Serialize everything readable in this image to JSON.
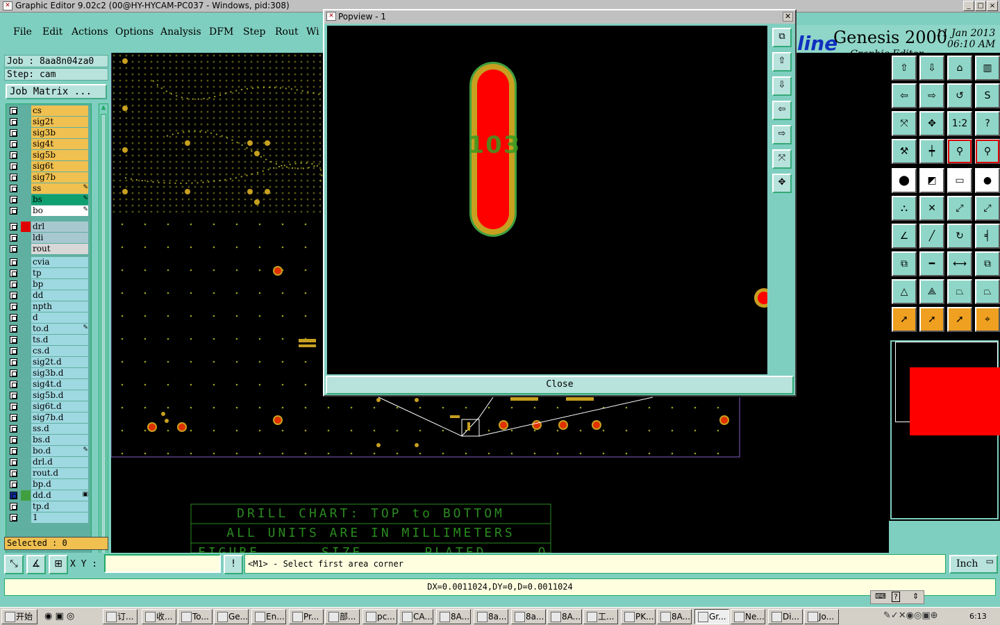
{
  "window": {
    "title": "Graphic Editor 9.02c2 (00@HY-HYCAM-PC037 - Windows, pid:308)",
    "controls": [
      "_",
      "□",
      "×"
    ]
  },
  "menu": {
    "items": [
      "File",
      "Edit",
      "Actions",
      "Options",
      "Analysis",
      "DFM",
      "Step",
      "Rout",
      "Wi"
    ]
  },
  "brand": {
    "logo": "line",
    "product": "Genesis 2000",
    "subtitle": "Graphic Editor",
    "date": "11 Jan 2013",
    "time": "06:10 AM"
  },
  "left_panel": {
    "job": "Job : 8aa8n04za0",
    "step": "Step: cam",
    "job_matrix_label": "Job Matrix ...",
    "selected": "Selected : 0",
    "layer_groups": [
      [
        {
          "name": "cs",
          "bg": "#f0c050"
        },
        {
          "name": "sig2t",
          "bg": "#f0c050"
        },
        {
          "name": "sig3b",
          "bg": "#f0c050"
        },
        {
          "name": "sig4t",
          "bg": "#f0c050"
        },
        {
          "name": "sig5b",
          "bg": "#f0c050"
        },
        {
          "name": "sig6t",
          "bg": "#f0c050"
        },
        {
          "name": "sig7b",
          "bg": "#f0c050"
        },
        {
          "name": "ss",
          "bg": "#f0c050",
          "flag": "✎"
        },
        {
          "name": "bs",
          "bg": "#10a070",
          "flag": "✎"
        },
        {
          "name": "bo",
          "bg": "#ffffff",
          "flag": "✎"
        }
      ],
      [
        {
          "name": "drl",
          "bg": "#a8c8d0",
          "swatch": "#e00000"
        },
        {
          "name": "ldi",
          "bg": "#a8c8d0"
        },
        {
          "name": "rout",
          "bg": "#d8d8d8"
        }
      ],
      [
        {
          "name": "cvia",
          "bg": "#9ed8e0"
        },
        {
          "name": "tp",
          "bg": "#9ed8e0"
        },
        {
          "name": "bp",
          "bg": "#9ed8e0"
        },
        {
          "name": "dd",
          "bg": "#9ed8e0"
        },
        {
          "name": "npth",
          "bg": "#9ed8e0"
        },
        {
          "name": "d",
          "bg": "#9ed8e0"
        },
        {
          "name": "to.d",
          "bg": "#9ed8e0",
          "flag": "✎"
        },
        {
          "name": "ts.d",
          "bg": "#9ed8e0"
        },
        {
          "name": "cs.d",
          "bg": "#9ed8e0"
        },
        {
          "name": "sig2t.d",
          "bg": "#9ed8e0"
        },
        {
          "name": "sig3b.d",
          "bg": "#9ed8e0"
        },
        {
          "name": "sig4t.d",
          "bg": "#9ed8e0"
        },
        {
          "name": "sig5b.d",
          "bg": "#9ed8e0"
        },
        {
          "name": "sig6t.d",
          "bg": "#9ed8e0"
        },
        {
          "name": "sig7b.d",
          "bg": "#9ed8e0"
        },
        {
          "name": "ss.d",
          "bg": "#9ed8e0"
        },
        {
          "name": "bs.d",
          "bg": "#9ed8e0"
        },
        {
          "name": "bo.d",
          "bg": "#9ed8e0",
          "flag": "✎"
        },
        {
          "name": "drl.d",
          "bg": "#9ed8e0"
        },
        {
          "name": "rout.d",
          "bg": "#9ed8e0"
        },
        {
          "name": "bp.d",
          "bg": "#9ed8e0"
        },
        {
          "name": "dd.d",
          "bg": "#9ed8e0",
          "swatch": "#40a040",
          "flag": "▣",
          "checked": true
        },
        {
          "name": "tp.d",
          "bg": "#9ed8e0"
        },
        {
          "name": "1",
          "bg": "#9ed8e0"
        }
      ]
    ]
  },
  "canvas": {
    "drill_chart_title": "DRILL CHART: TOP to BOTTOM",
    "drill_chart_units": "ALL UNITS ARE IN MILLIMETERS",
    "drill_chart_header_partial": "FIGURE      SIZE      PLATED     QTY"
  },
  "popview": {
    "title": "Popview - 1",
    "close_label": "Close",
    "pad_text": "103"
  },
  "command_bar": {
    "xy_label": "X Y :",
    "xy_value": "",
    "prompt": "<M1> - Select first area corner",
    "units": "Inch"
  },
  "status": {
    "measure": "DX=0.0011024,DY=0,D=0.0011024"
  },
  "taskbar": {
    "start": "开始",
    "items": [
      "订...",
      "收...",
      "To...",
      "Ge...",
      "En...",
      "Pr...",
      "部...",
      "pc...",
      "CA...",
      "8A...",
      "8a...",
      "8a...",
      "8A...",
      "工...",
      "PK...",
      "8A...",
      "Gr...",
      "Ne...",
      "Di...",
      "Jo..."
    ],
    "active_index": 16,
    "clock": "6:13"
  },
  "colors": {
    "teal": "#7fcfc0",
    "pad_copper": "#c8a020",
    "pad_red": "#ff0000",
    "pad_green": "#40a040"
  }
}
